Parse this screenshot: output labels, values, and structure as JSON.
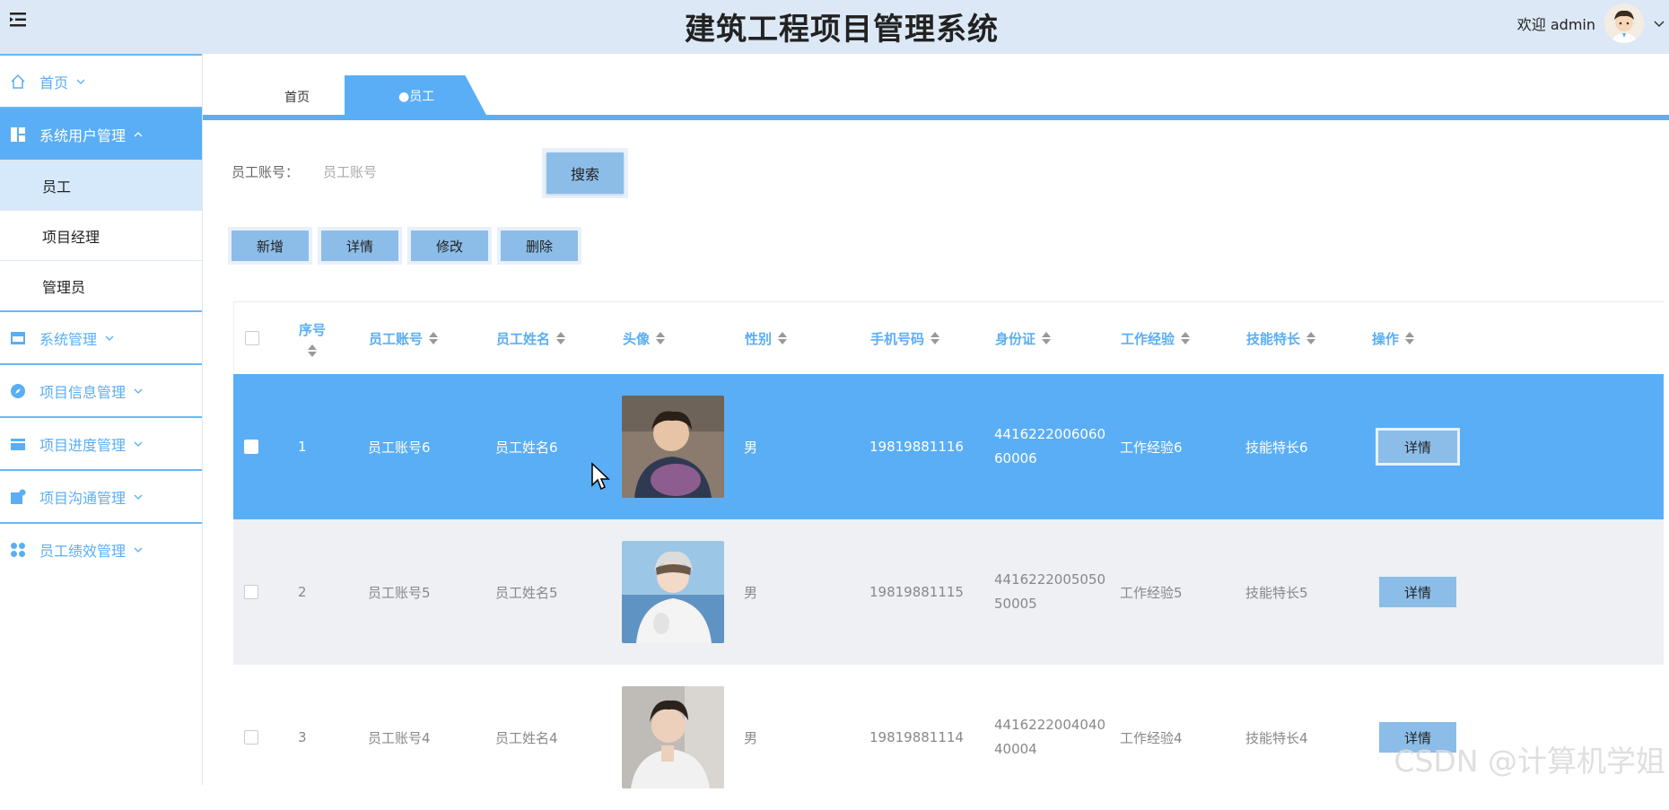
{
  "header": {
    "title": "建筑工程项目管理系统",
    "welcome": "欢迎 admin",
    "avatar_icon": "user-avatar"
  },
  "sidebar": {
    "items": [
      {
        "label": "首页",
        "icon": "home-icon"
      },
      {
        "label": "系统用户管理",
        "icon": "dashboard-icon"
      },
      {
        "label": "系统管理",
        "icon": "store-icon"
      },
      {
        "label": "项目信息管理",
        "icon": "compass-icon"
      },
      {
        "label": "项目进度管理",
        "icon": "box-icon"
      },
      {
        "label": "项目沟通管理",
        "icon": "chat-icon"
      },
      {
        "label": "员工绩效管理",
        "icon": "grid-icon"
      }
    ],
    "subitems": [
      "员工",
      "项目经理",
      "管理员"
    ]
  },
  "tabs": {
    "home": "首页",
    "active": "●员工",
    "close": "×"
  },
  "search": {
    "label": "员工账号：",
    "placeholder": "员工账号",
    "button": "搜索"
  },
  "actions": [
    "新增",
    "详情",
    "修改",
    "删除"
  ],
  "table": {
    "headers": [
      "序号",
      "员工账号",
      "员工姓名",
      "头像",
      "性别",
      "手机号码",
      "身份证",
      "工作经验",
      "技能特长",
      "操作"
    ],
    "rows": [
      {
        "index": "1",
        "account": "员工账号6",
        "name": "员工姓名6",
        "gender": "男",
        "phone": "19819881116",
        "id_line1": "4416222006060",
        "id_line2": "60006",
        "experience": "工作经验6",
        "skill": "技能特长6",
        "action": "详情"
      },
      {
        "index": "2",
        "account": "员工账号5",
        "name": "员工姓名5",
        "gender": "男",
        "phone": "19819881115",
        "id_line1": "4416222005050",
        "id_line2": "50005",
        "experience": "工作经验5",
        "skill": "技能特长5",
        "action": "详情"
      },
      {
        "index": "3",
        "account": "员工账号4",
        "name": "员工姓名4",
        "gender": "男",
        "phone": "19819881114",
        "id_line1": "4416222004040",
        "id_line2": "40004",
        "experience": "工作经验4",
        "skill": "技能特长4",
        "action": "详情"
      }
    ]
  },
  "watermark": "CSDN @计算机学姐",
  "colors": {
    "accent": "#5aaef5",
    "header_bg": "#dce8f6",
    "button_bg": "#8bbde8"
  }
}
